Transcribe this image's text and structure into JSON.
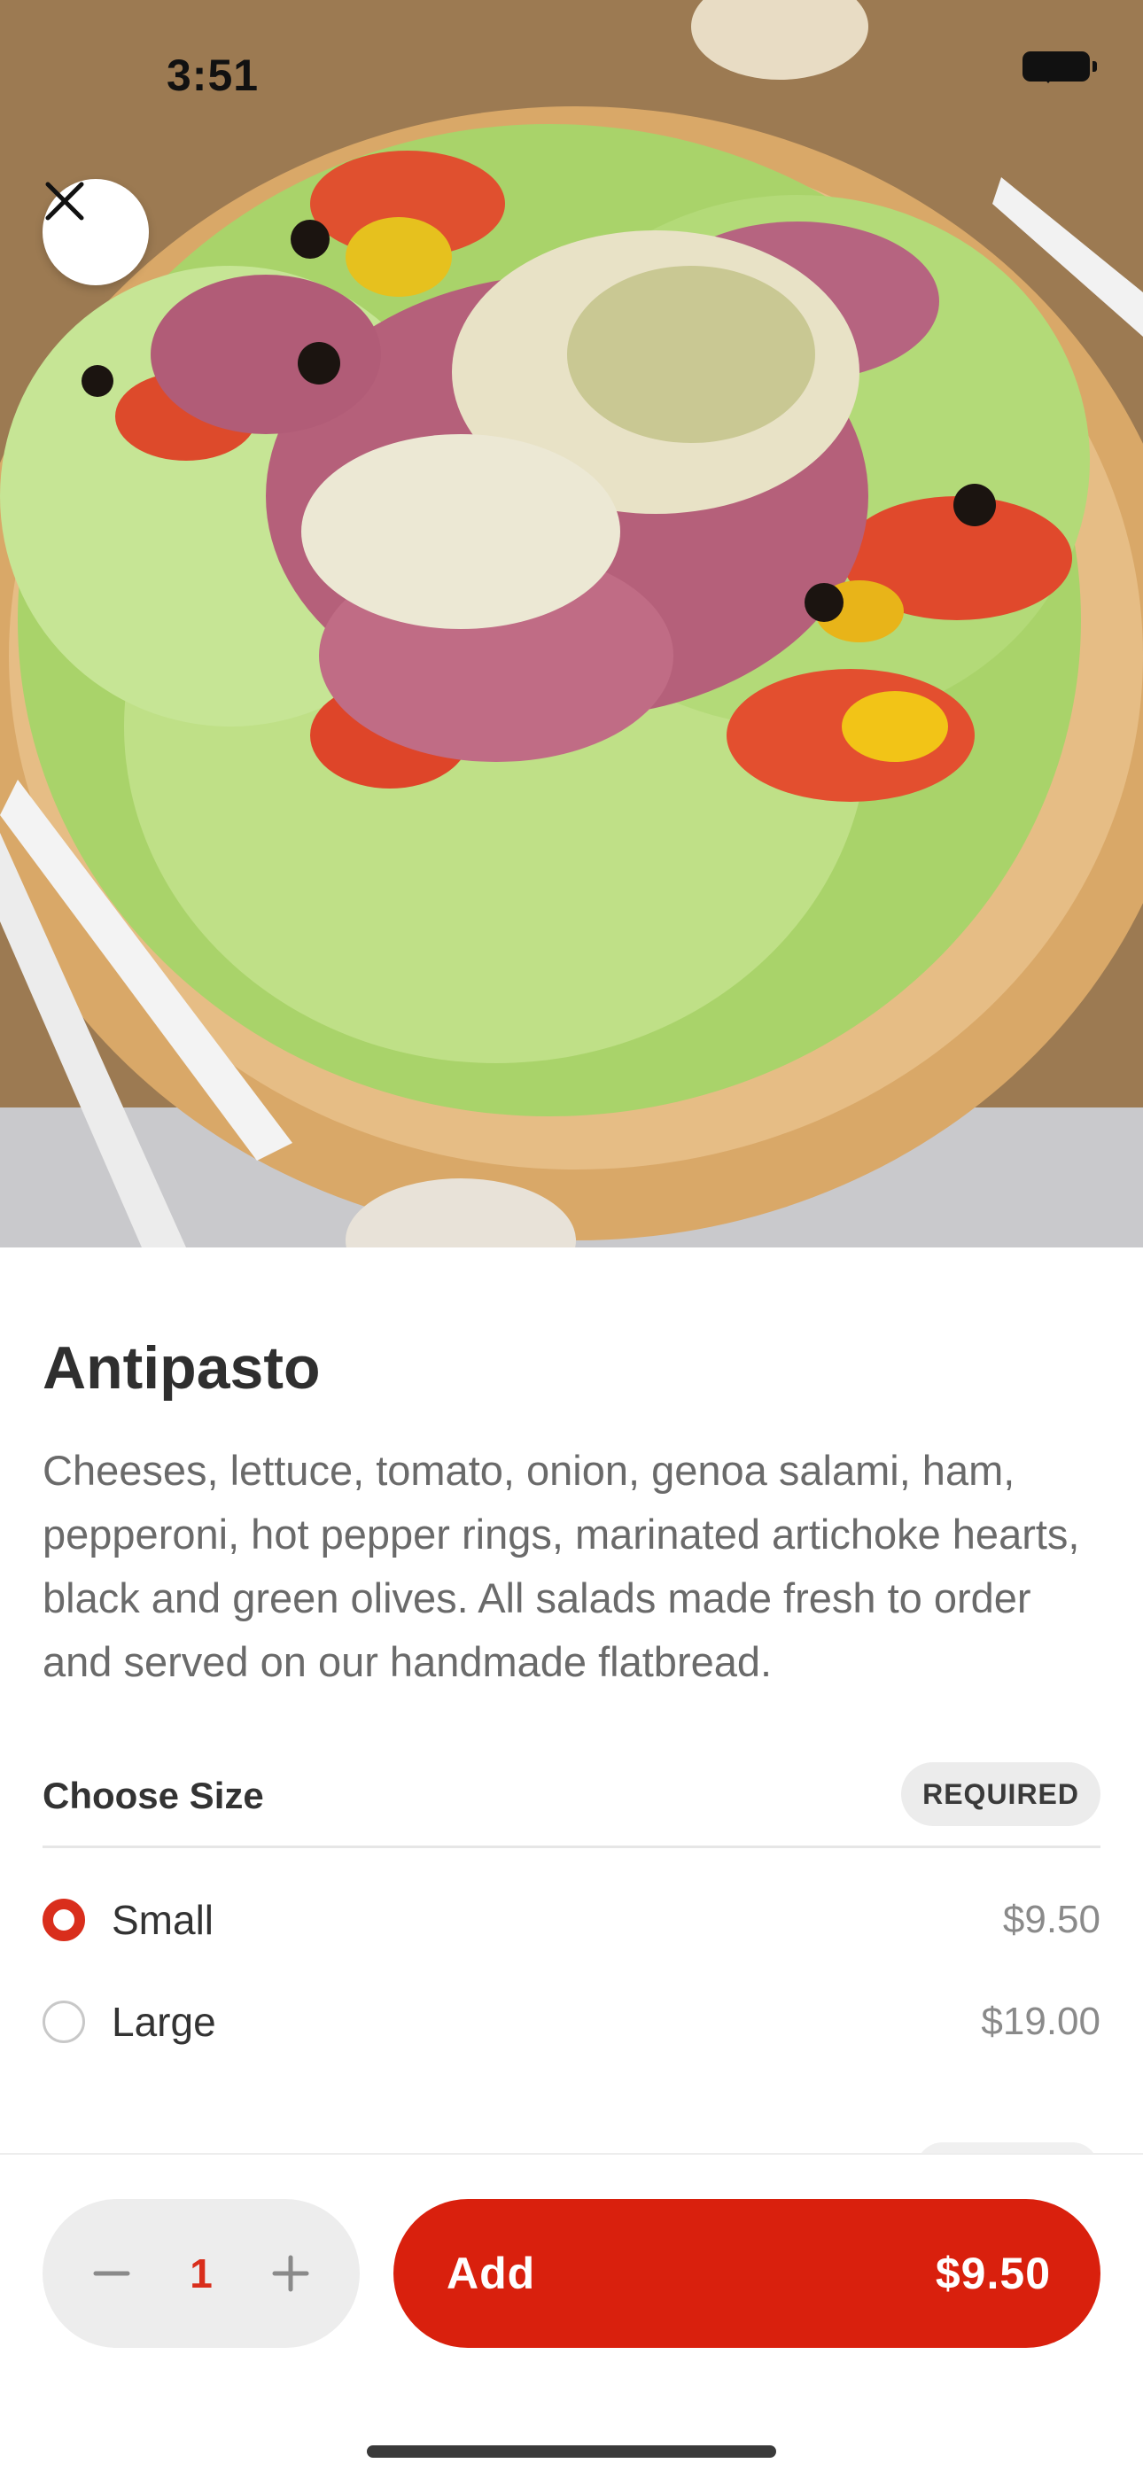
{
  "status_bar": {
    "time": "3:51"
  },
  "hero": {
    "alt": "Antipasto salad flatbread photo"
  },
  "item": {
    "title": "Antipasto",
    "description": "Cheeses, lettuce, tomato, onion, genoa salami, ham, pepperoni, hot pepper rings, marinated artichoke hearts, black and green olives.  All salads made fresh to order and served on our handmade flatbread."
  },
  "size_section": {
    "title": "Choose Size",
    "badge": "REQUIRED",
    "options": [
      {
        "label": "Small",
        "price": "$9.50",
        "selected": true
      },
      {
        "label": "Large",
        "price": "$19.00",
        "selected": false
      }
    ]
  },
  "footer": {
    "quantity": "1",
    "add_label": "Add",
    "add_price": "$9.50"
  },
  "colors": {
    "accent": "#d9200d",
    "text_primary": "#2f2f2f",
    "text_secondary": "#6a6a6a"
  }
}
